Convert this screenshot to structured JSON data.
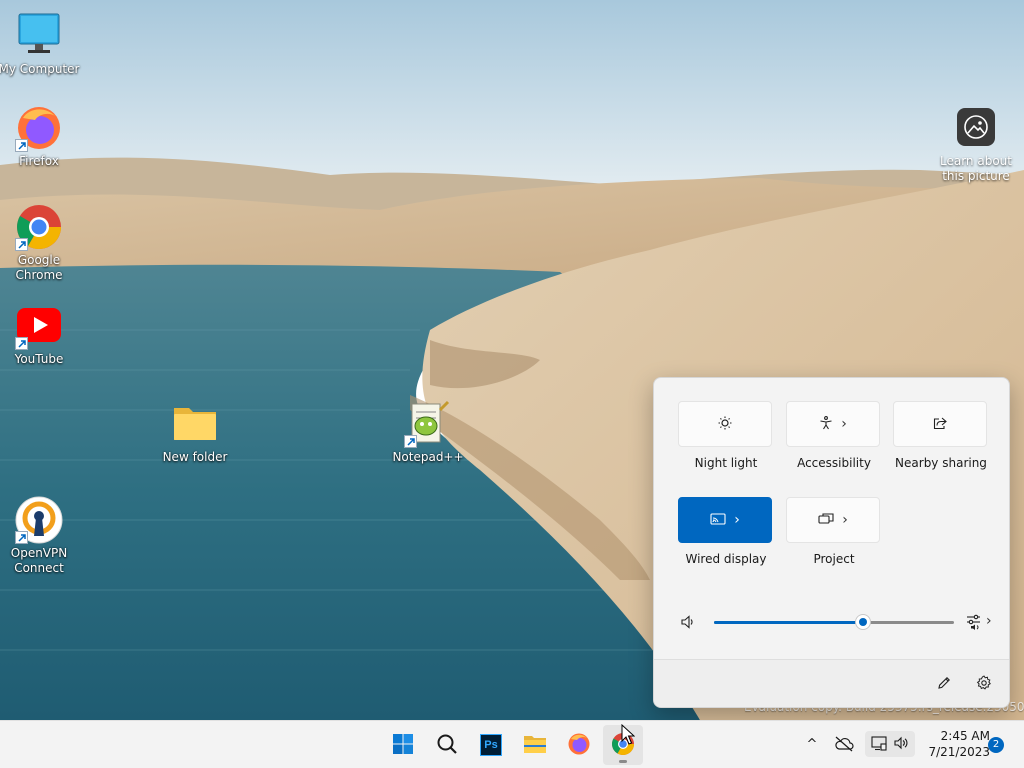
{
  "desktop": {
    "icons": [
      {
        "label": "My Computer"
      },
      {
        "label": "Firefox"
      },
      {
        "label": "Google\nChrome"
      },
      {
        "label": "YouTube"
      },
      {
        "label": "OpenVPN\nConnect"
      },
      {
        "label": "New folder"
      },
      {
        "label": "Notepad++"
      }
    ],
    "learn_label": "Learn about\nthis picture",
    "watermark": "Evaluation copy. Build 25375.rs_release.230507-1632"
  },
  "quick_settings": {
    "tiles": [
      {
        "label": "Night light",
        "icon": "brightness-icon",
        "has_chevron": false,
        "active": false
      },
      {
        "label": "Accessibility",
        "icon": "accessibility-icon",
        "has_chevron": true,
        "active": false
      },
      {
        "label": "Nearby sharing",
        "icon": "share-icon",
        "has_chevron": false,
        "active": false
      },
      {
        "label": "Wired display",
        "icon": "cast-icon",
        "has_chevron": true,
        "active": true
      },
      {
        "label": "Project",
        "icon": "project-icon",
        "has_chevron": true,
        "active": false
      }
    ],
    "chevron_glyph": "›",
    "volume_level": 0.62
  },
  "taskbar": {
    "apps": [
      "start-icon",
      "search-icon",
      "photoshop-icon",
      "file-explorer-icon",
      "firefox-icon",
      "chrome-icon"
    ],
    "photoshop_text": "Ps",
    "tray_chevron": "^",
    "clock_time": "2:45 AM",
    "clock_date": "7/21/2023",
    "notification_count": "2"
  },
  "colors": {
    "accent": "#0067c0",
    "taskbar": "#f3f3f3",
    "flyout": "#f3f3f3"
  }
}
